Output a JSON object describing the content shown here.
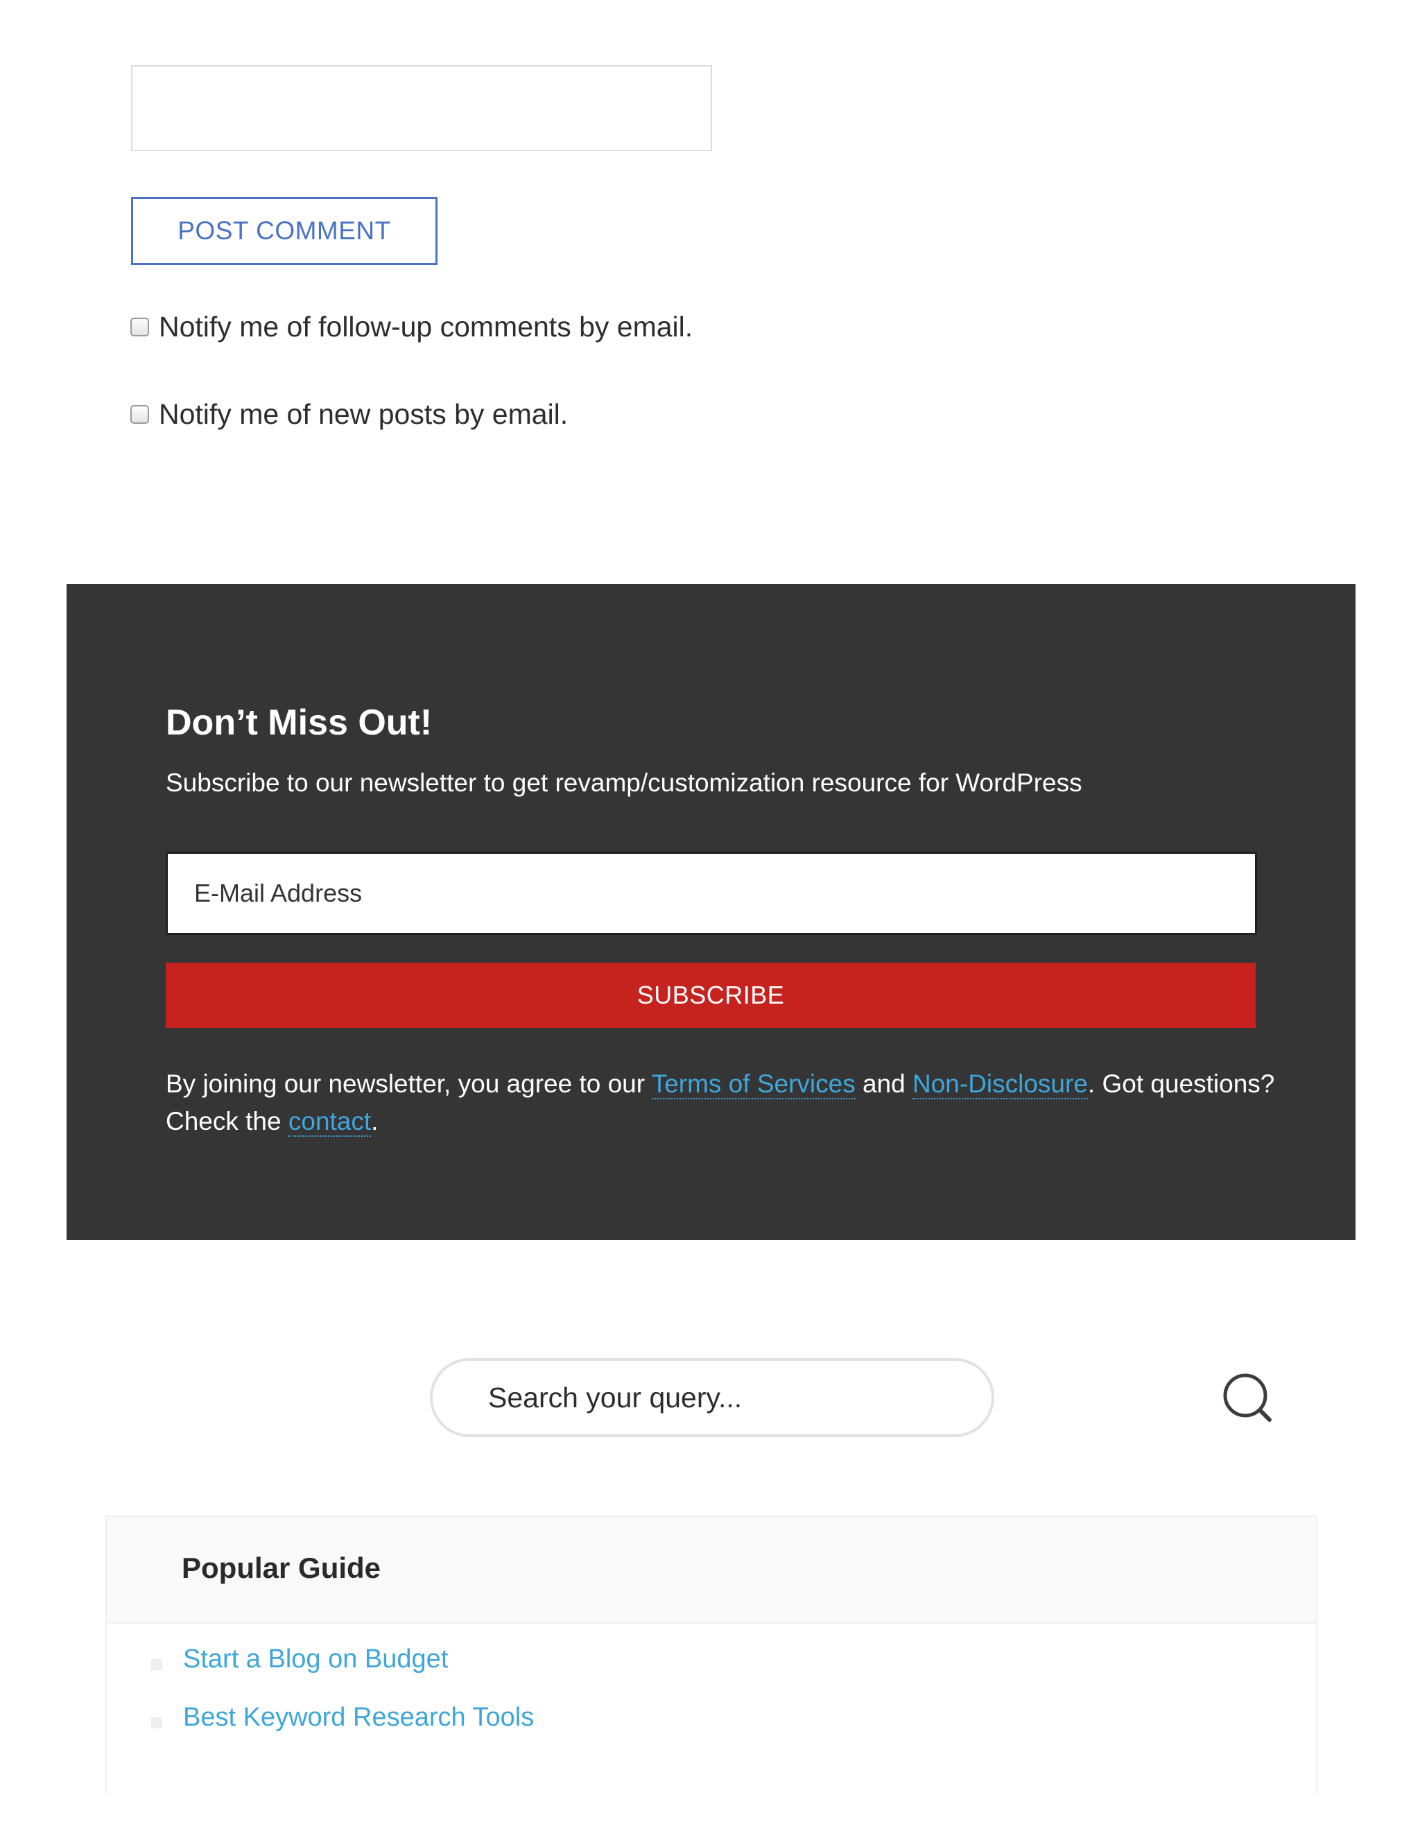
{
  "comment_form": {
    "url_field_value": "",
    "post_comment_label": "POST COMMENT",
    "notify_followup_label": "Notify me of follow-up comments by email.",
    "notify_new_posts_label": "Notify me of new posts by email."
  },
  "newsletter": {
    "title": "Don’t Miss Out!",
    "subtitle": "Subscribe to our newsletter to get revamp/customization resource for WordPress",
    "email_placeholder": "E-Mail Address",
    "subscribe_label": "SUBSCRIBE",
    "legal": {
      "part1": "By joining our newsletter, you agree to our ",
      "terms_link": "Terms of Services",
      "part2": " and ",
      "nda_link": "Non-Disclosure",
      "part3": ". Got questions? Check the ",
      "contact_link": "contact",
      "part4": "."
    }
  },
  "search": {
    "placeholder": "Search your query...",
    "icon": "search-icon"
  },
  "popular_guide": {
    "title": "Popular Guide",
    "items": [
      {
        "label": "Start a Blog on Budget"
      },
      {
        "label": "Best Keyword Research Tools"
      }
    ]
  },
  "colors": {
    "accent_blue": "#4a72c7",
    "link_blue": "#3fa6db",
    "newsletter_bg": "#353536",
    "subscribe_red": "#c6231e"
  }
}
